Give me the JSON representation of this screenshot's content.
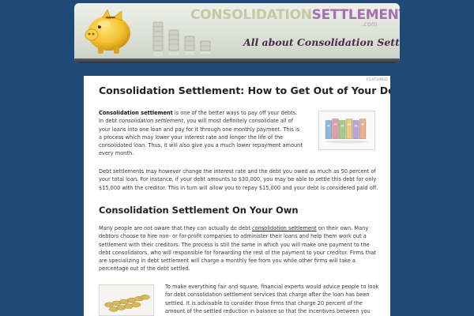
{
  "header": {
    "logo_part1": "CONSOLIDATION",
    "logo_part2": "SETTLEMENT",
    "logo_suffix": ".com",
    "tagline": "All about Consolidation Settlements!"
  },
  "post": {
    "badge": "FEATURED",
    "title": "Consolidation Settlement: How to Get Out of Your Debts",
    "p1_bold": "Consolidation settlement",
    "p1_a": " is one of the better ways to pay off your debts. In debt ",
    "p1_italic": "consolidation settlement",
    "p1_b": ", you will most definitely consolidate all of your loans into one loan and pay for it through one monthly payment. This is a process which may lower your interest rate and longer the life of the consolidated loan. Thus, it will also give you a much lower repayment amount every month.",
    "p2": "Debt settlements may however change the interest rate and the debt you owed as much as 50 percent of your total loan. For instance, if your debt amounts to $30,000, you may be able to settle this debt for only $15,000 with the creditor. This in turn will allow you to repay $15,000 and your debt is considered paid off.",
    "heading2": "Consolidation Settlement On Your Own",
    "p3_a": "Many people are not aware that they can actually do debt ",
    "p3_link": "consolidation settlement",
    "p3_b": " on their own. Many debtors choose to hire non- or for-profit companies to administer their loans and help them work out a settlement with their creditors. The process is still the same in which you will make one payment to the debt consolidators, who will responsible for forwarding the rest of the payment to your creditor. Firms that are specializing in debt settlement will charge a monthly fee from you while other firms will take a percentage out of the debt settled.",
    "p4": "To make everything fair and square, financial experts would advice people to look for debt consolidation settlement services that charge after the loan has been settled. It is advisable to consider those firms that charge 20 percent of the amount of the settled reduction in balance so that the incentives between you"
  },
  "icons": {
    "banner_piggy": "piggy-bank-icon",
    "banner_coins": "coin-stacks-icon",
    "thumb1": "banknotes-image",
    "thumb2": "coins-image"
  },
  "colors": {
    "page_bg": "#1f4a78",
    "logo_primary": "#c6c8a0",
    "logo_accent": "#a56fb0",
    "tagline": "#4a2a4c",
    "piggy": "#f2c12e"
  }
}
